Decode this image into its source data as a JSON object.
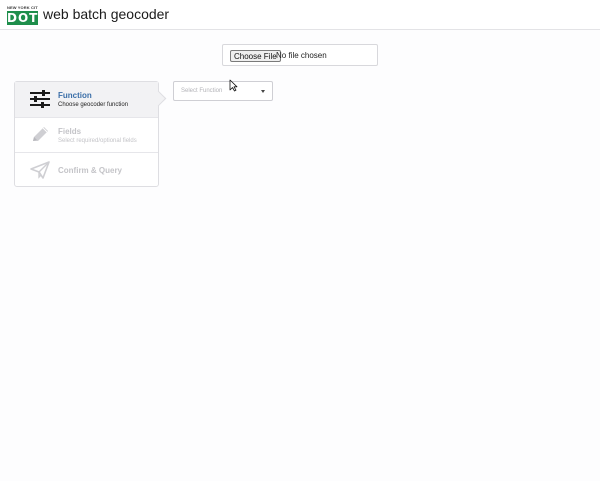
{
  "header": {
    "logo_top_text": "NEW YORK CITY",
    "logo_mark_text": "DOT",
    "title": "web batch geocoder"
  },
  "file_input": {
    "button_label": "Choose File",
    "status_text": "No file chosen"
  },
  "steps": [
    {
      "title": "Function",
      "description": "Choose geocoder function",
      "icon": "sliders-icon",
      "state": "active"
    },
    {
      "title": "Fields",
      "description": "Select required/optional fields",
      "icon": "pencil-icon",
      "state": "disabled"
    },
    {
      "title": "Confirm & Query",
      "description": "",
      "icon": "paper-plane-icon",
      "state": "disabled"
    }
  ],
  "function_select": {
    "placeholder": "Select Function"
  },
  "colors": {
    "brand_green": "#1e8e4b",
    "active_step_title": "#3a6ea8",
    "disabled_text": "#c4c4c8"
  }
}
